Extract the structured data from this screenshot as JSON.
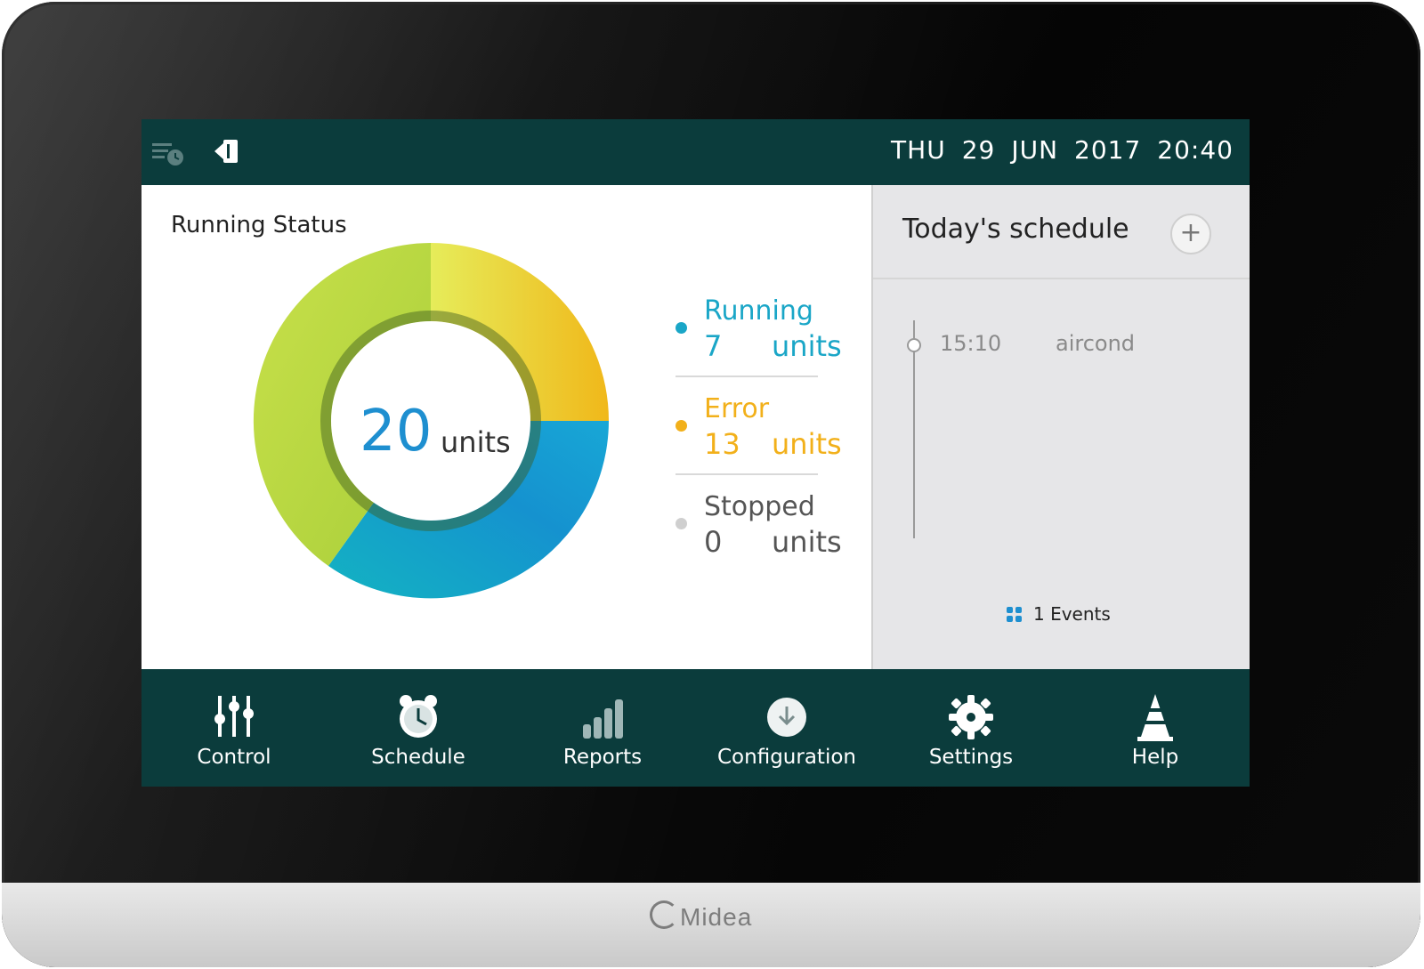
{
  "colors": {
    "bar": "#0b3c3c",
    "running": "#1aa6c7",
    "error": "#f2b01a",
    "stopped": "#bdbdbd",
    "total": "#1e8fd0"
  },
  "topbar": {
    "icons": [
      "schedule-list-icon",
      "logout-icon"
    ],
    "day": "THU",
    "date": "29",
    "month": "JUN",
    "year": "2017",
    "time": "20:40"
  },
  "status": {
    "title": "Running Status",
    "total_value": "20",
    "total_unit": "units",
    "items": [
      {
        "label": "Running",
        "value": "7",
        "unit": "units"
      },
      {
        "label": "Error",
        "value": "13",
        "unit": "units"
      },
      {
        "label": "Stopped",
        "value": "0",
        "unit": "units"
      }
    ]
  },
  "schedule": {
    "title": "Today's schedule",
    "add_label": "+",
    "events": [
      {
        "time": "15:10",
        "name": "aircond"
      }
    ],
    "events_count": "1 Events"
  },
  "nav": [
    {
      "label": "Control",
      "icon": "sliders-icon"
    },
    {
      "label": "Schedule",
      "icon": "alarm-clock-icon"
    },
    {
      "label": "Reports",
      "icon": "bar-chart-icon"
    },
    {
      "label": "Configuration",
      "icon": "download-icon"
    },
    {
      "label": "Settings",
      "icon": "gear-icon"
    },
    {
      "label": "Help",
      "icon": "cone-icon"
    }
  ],
  "brand": "Midea"
}
